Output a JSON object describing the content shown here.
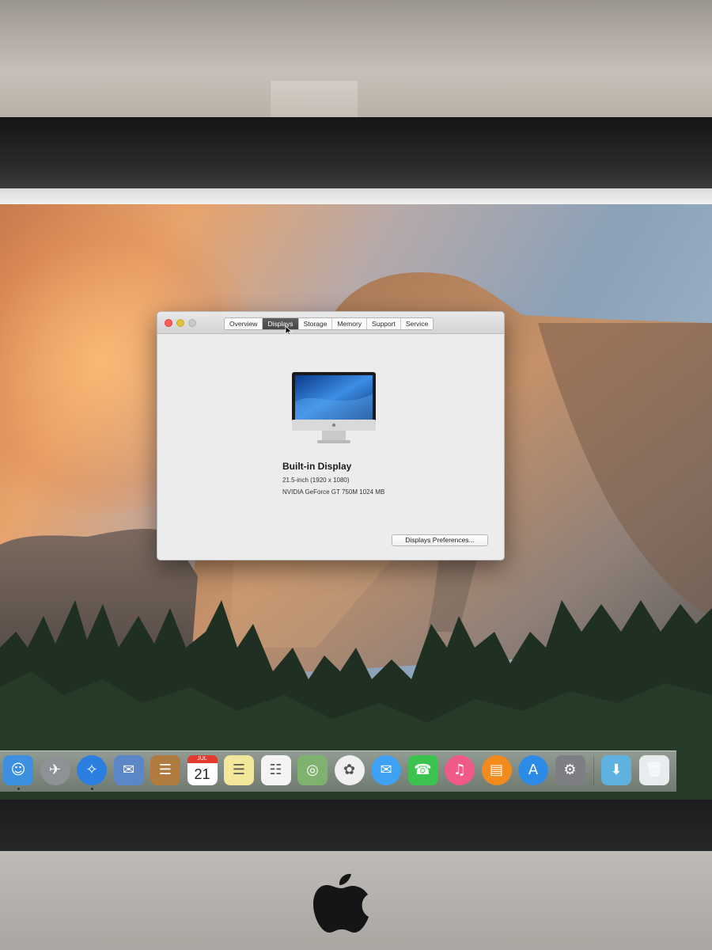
{
  "window": {
    "tabs": [
      {
        "label": "Overview",
        "active": false
      },
      {
        "label": "Displays",
        "active": true
      },
      {
        "label": "Storage",
        "active": false
      },
      {
        "label": "Memory",
        "active": false
      },
      {
        "label": "Support",
        "active": false
      },
      {
        "label": "Service",
        "active": false
      }
    ],
    "display": {
      "name": "Built-in Display",
      "size": "21.5-inch (1920 x 1080)",
      "graphics": "NVIDIA GeForce GT 750M 1024 MB"
    },
    "preferences_button": "Displays Preferences..."
  },
  "calendar": {
    "month": "JUL",
    "day": "21"
  },
  "dock": {
    "apps": [
      {
        "name": "finder",
        "color": "#3d8fe0",
        "glyph": "☺"
      },
      {
        "name": "launchpad",
        "color": "#8e9196",
        "glyph": "✈"
      },
      {
        "name": "safari",
        "color": "#2b7fe0",
        "glyph": "✧"
      },
      {
        "name": "mail",
        "color": "#5b86c8",
        "glyph": "✉"
      },
      {
        "name": "contacts",
        "color": "#b07b3e",
        "glyph": "☰"
      },
      {
        "name": "calendar",
        "color": "#ffffff",
        "glyph": ""
      },
      {
        "name": "notes",
        "color": "#f3e79c",
        "glyph": "☰"
      },
      {
        "name": "reminders",
        "color": "#f4f4f4",
        "glyph": "☷"
      },
      {
        "name": "maps",
        "color": "#7fb26e",
        "glyph": "◎"
      },
      {
        "name": "photos",
        "color": "#f0f0f0",
        "glyph": "✿"
      },
      {
        "name": "messages",
        "color": "#3ea1f4",
        "glyph": "✉"
      },
      {
        "name": "facetime",
        "color": "#3cc24f",
        "glyph": "☎"
      },
      {
        "name": "itunes",
        "color": "#f05a88",
        "glyph": "♫"
      },
      {
        "name": "ibooks",
        "color": "#f28b1d",
        "glyph": "▤"
      },
      {
        "name": "app-store",
        "color": "#2d8be8",
        "glyph": "A"
      },
      {
        "name": "system-preferences",
        "color": "#7d7f84",
        "glyph": "⚙"
      }
    ],
    "stack": {
      "name": "downloads",
      "color": "#5fb2e0",
      "glyph": "⬇"
    },
    "trash": {
      "name": "trash",
      "color": "#e8ecef",
      "glyph": "🗑"
    }
  }
}
